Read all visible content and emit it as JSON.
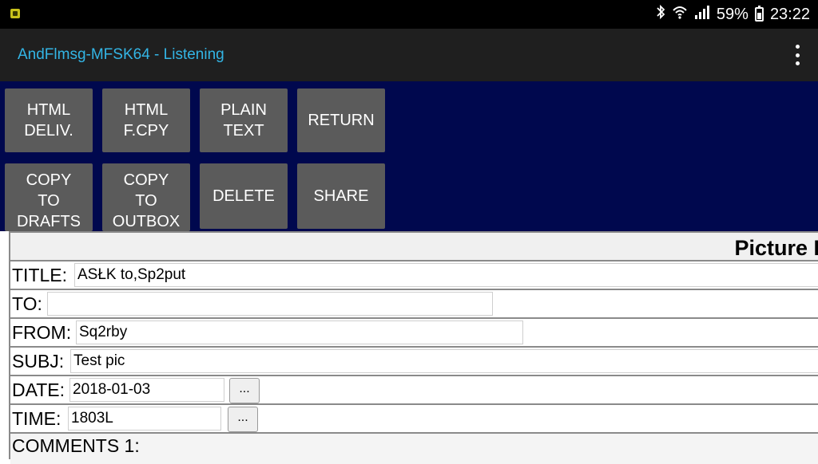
{
  "status_bar": {
    "battery_percent": "59%",
    "time": "23:22",
    "icons": [
      "notification-icon",
      "bluetooth-icon",
      "wifi-icon",
      "signal-icon",
      "battery-icon"
    ]
  },
  "action_bar": {
    "title": "AndFlmsg-MFSK64 - Listening",
    "menu_icon": "overflow-menu-icon"
  },
  "buttons": {
    "html_deliv": "HTML\nDELIV.",
    "html_fcopy": "HTML\nF.CPY",
    "plain_text": "PLAIN\nTEXT",
    "return": "RETURN",
    "copy_to_drafts": "COPY\nTO\nDRAFTS",
    "copy_to_outbox": "COPY\nTO\nOUTBOX",
    "delete": "DELETE",
    "share": "SHARE"
  },
  "form": {
    "header_title": "Picture I",
    "title_label": "TITLE:",
    "title_value": "ASŁK to,Sp2put",
    "to_label": "TO:",
    "to_value": "",
    "from_label": "FROM:",
    "from_value": "Sq2rby",
    "subj_label": "SUBJ:",
    "subj_value": "Test pic",
    "date_label": "DATE:",
    "date_value": "2018-01-03",
    "date_picker": "...",
    "time_label": "TIME:",
    "time_value": "1803L",
    "time_picker": "...",
    "comments_label": "COMMENTS 1:"
  },
  "colors": {
    "title_accent": "#33b5e5",
    "panel_background": "#00084e",
    "button_background": "#5b5b5b"
  }
}
